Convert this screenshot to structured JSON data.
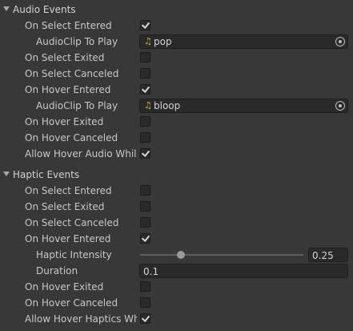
{
  "audio_events": {
    "header": "Audio Events",
    "on_select_entered": {
      "label": "On Select Entered",
      "checked": true
    },
    "audioclip_select": {
      "label": "AudioClip To Play",
      "value": "pop",
      "icon": "audio-clip-icon"
    },
    "on_select_exited": {
      "label": "On Select Exited",
      "checked": false
    },
    "on_select_canceled": {
      "label": "On Select Canceled",
      "checked": false
    },
    "on_hover_entered": {
      "label": "On Hover Entered",
      "checked": true
    },
    "audioclip_hover": {
      "label": "AudioClip To Play",
      "value": "bloop",
      "icon": "audio-clip-icon"
    },
    "on_hover_exited": {
      "label": "On Hover Exited",
      "checked": false
    },
    "on_hover_canceled": {
      "label": "On Hover Canceled",
      "checked": false
    },
    "allow_hover_audio": {
      "label": "Allow Hover Audio While Selecting",
      "checked": true
    }
  },
  "haptic_events": {
    "header": "Haptic Events",
    "on_select_entered": {
      "label": "On Select Entered",
      "checked": false
    },
    "on_select_exited": {
      "label": "On Select Exited",
      "checked": false
    },
    "on_select_canceled": {
      "label": "On Select Canceled",
      "checked": false
    },
    "on_hover_entered": {
      "label": "On Hover Entered",
      "checked": true
    },
    "haptic_intensity": {
      "label": "Haptic Intensity",
      "value": "0.25",
      "fraction": 0.25
    },
    "duration": {
      "label": "Duration",
      "value": "0.1"
    },
    "on_hover_exited": {
      "label": "On Hover Exited",
      "checked": false
    },
    "on_hover_canceled": {
      "label": "On Hover Canceled",
      "checked": false
    },
    "allow_hover_haptics": {
      "label": "Allow Hover Haptics While Selecting",
      "checked": true
    }
  },
  "colors": {
    "background": "#383838",
    "field": "#2a2a2a",
    "text": "#c8c8c8",
    "audio_icon": "#d8b33d"
  }
}
